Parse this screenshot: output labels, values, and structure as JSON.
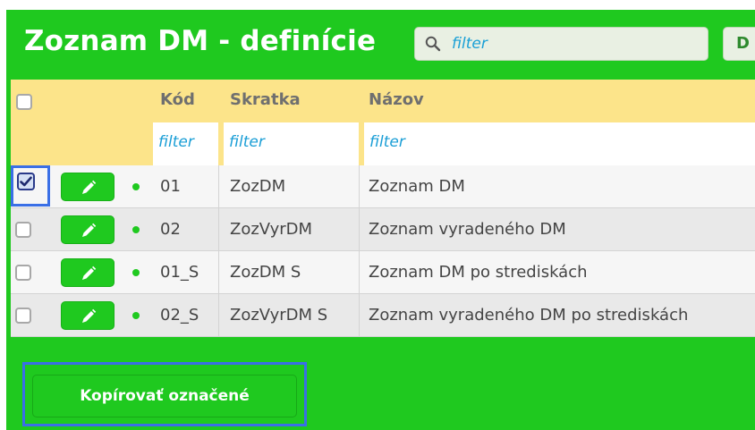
{
  "header": {
    "title": "Zoznam DM - definície",
    "search_placeholder": "filter",
    "side_button_label": "D"
  },
  "table": {
    "columns": [
      "Kód",
      "Skratka",
      "Názov"
    ],
    "filters": [
      "filter",
      "filter",
      "filter"
    ],
    "rows": [
      {
        "code": "01",
        "short": "ZozDM",
        "name": "Zoznam DM",
        "checked": true
      },
      {
        "code": "02",
        "short": "ZozVyrDM",
        "name": "Zoznam vyradeného DM",
        "checked": false
      },
      {
        "code": "01_S",
        "short": "ZozDM S",
        "name": "Zoznam DM po strediskách",
        "checked": false
      },
      {
        "code": "02_S",
        "short": "ZozVyrDM S",
        "name": "Zoznam vyradeného DM po strediskách",
        "checked": false
      }
    ]
  },
  "actions": {
    "copy_selected_label": "Kopírovať označené"
  },
  "colors": {
    "brand_green": "#1fc91f",
    "header_yellow": "#fce48a",
    "filter_text": "#1a9ed6",
    "highlight_blue": "#3a6fe6"
  }
}
